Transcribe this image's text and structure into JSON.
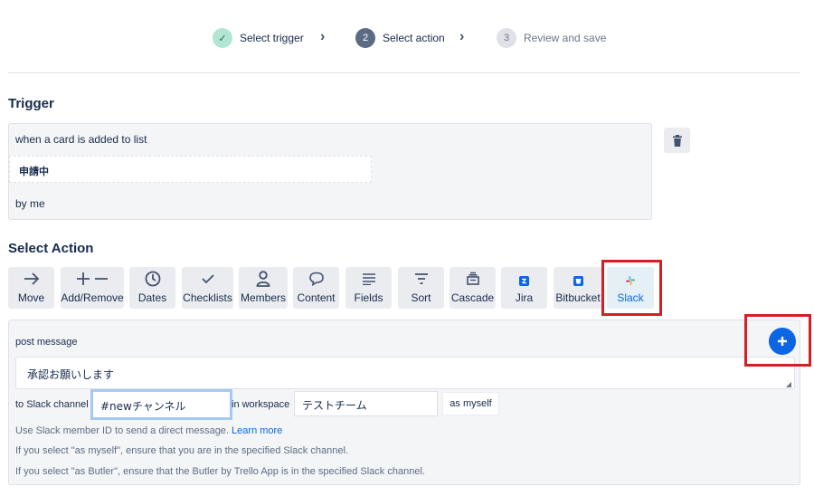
{
  "stepper": {
    "steps": [
      {
        "number": "✓",
        "label": "Select trigger",
        "state": "done"
      },
      {
        "number": "2",
        "label": "Select action",
        "state": "active"
      },
      {
        "number": "3",
        "label": "Review and save",
        "state": "pending"
      }
    ]
  },
  "trigger": {
    "title": "Trigger",
    "line1": "when a card is added to list",
    "list_name": "申請中",
    "line3": "by me"
  },
  "select_action": {
    "title": "Select Action",
    "tabs": [
      {
        "label": "Move",
        "icon": "arrow-right-icon"
      },
      {
        "label": "Add/Remove",
        "icon": "plus-minus-icon"
      },
      {
        "label": "Dates",
        "icon": "clock-icon"
      },
      {
        "label": "Checklists",
        "icon": "check-icon"
      },
      {
        "label": "Members",
        "icon": "person-icon"
      },
      {
        "label": "Content",
        "icon": "speech-bubble-icon"
      },
      {
        "label": "Fields",
        "icon": "lines-icon"
      },
      {
        "label": "Sort",
        "icon": "filter-icon"
      },
      {
        "label": "Cascade",
        "icon": "stack-icon"
      },
      {
        "label": "Jira",
        "icon": "jira-icon"
      },
      {
        "label": "Bitbucket",
        "icon": "bitbucket-icon"
      },
      {
        "label": "Slack",
        "icon": "slack-icon",
        "selected": true
      }
    ]
  },
  "action_panel": {
    "post_label": "post message",
    "message_value": "承認お願いします",
    "channel_label": "to Slack channel",
    "channel_value": "#newチャンネル",
    "workspace_label": "in workspace",
    "workspace_value": "テストチーム",
    "as_myself_label": "as myself",
    "help1_text": "Use Slack member ID to send a direct message.",
    "help1_link": "Learn more",
    "help2": "If you select \"as myself\", ensure that you are in the specified Slack channel.",
    "help3": "If you select \"as Butler\", ensure that the Butler by Trello App is in the specified Slack channel."
  },
  "colors": {
    "accent": "#0c66e4",
    "highlight": "#d32027",
    "step_done": "#b3e5d3",
    "step_active": "#5a6b83"
  }
}
